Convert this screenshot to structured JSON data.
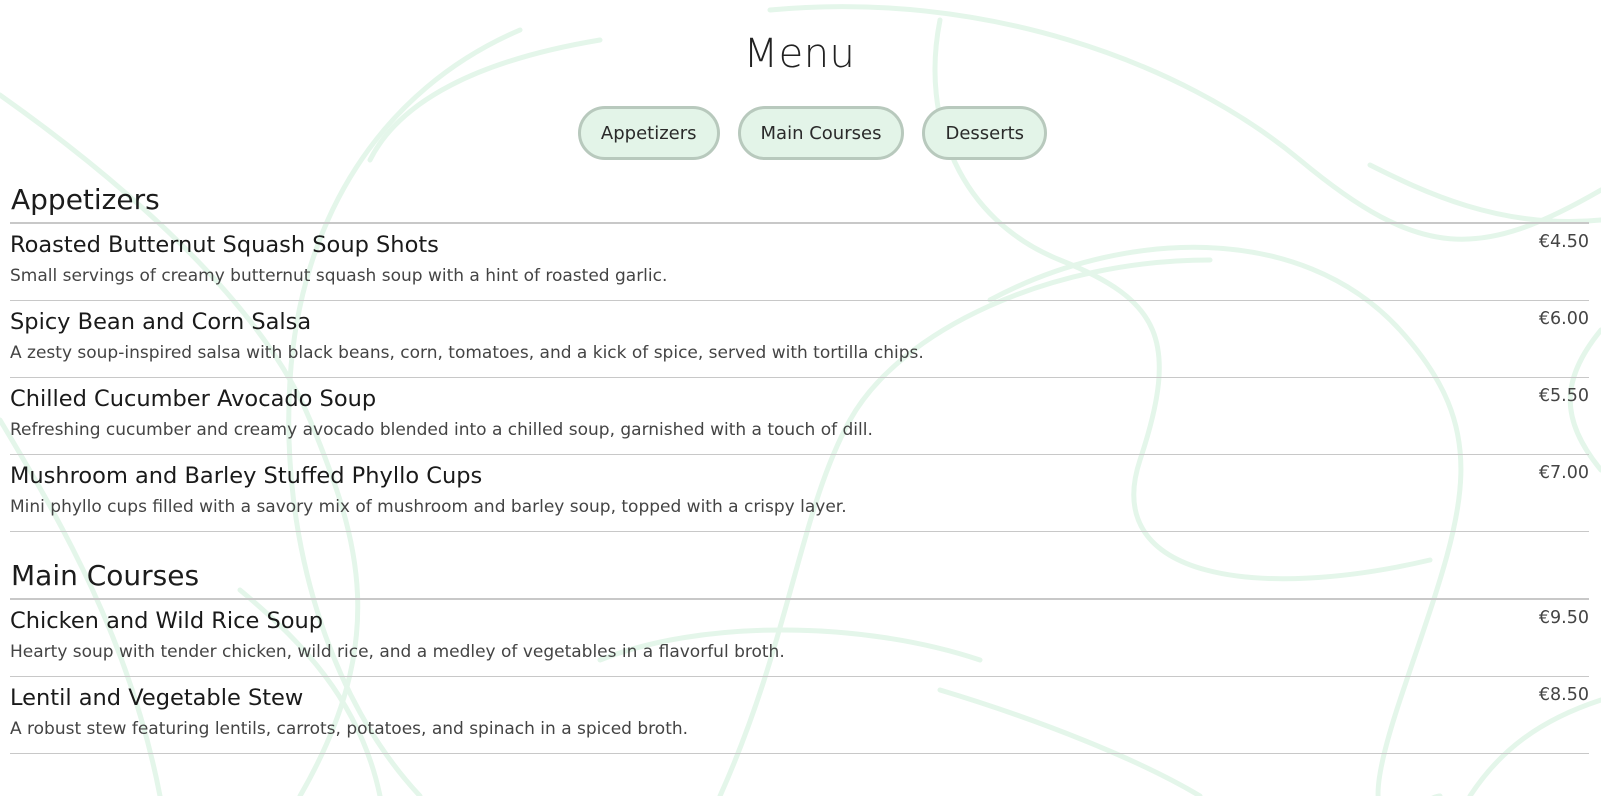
{
  "page": {
    "title": "Menu"
  },
  "categories": [
    {
      "label": "Appetizers"
    },
    {
      "label": "Main Courses"
    },
    {
      "label": "Desserts"
    }
  ],
  "sections": [
    {
      "title": "Appetizers",
      "items": [
        {
          "name": "Roasted Butternut Squash Soup Shots",
          "description": "Small servings of creamy butternut squash soup with a hint of roasted garlic.",
          "price": "€4.50"
        },
        {
          "name": "Spicy Bean and Corn Salsa",
          "description": "A zesty soup-inspired salsa with black beans, corn, tomatoes, and a kick of spice, served with tortilla chips.",
          "price": "€6.00"
        },
        {
          "name": "Chilled Cucumber Avocado Soup",
          "description": "Refreshing cucumber and creamy avocado blended into a chilled soup, garnished with a touch of dill.",
          "price": "€5.50"
        },
        {
          "name": "Mushroom and Barley Stuffed Phyllo Cups",
          "description": "Mini phyllo cups filled with a savory mix of mushroom and barley soup, topped with a crispy layer.",
          "price": "€7.00"
        }
      ]
    },
    {
      "title": "Main Courses",
      "items": [
        {
          "name": "Chicken and Wild Rice Soup",
          "description": "Hearty soup with tender chicken, wild rice, and a medley of vegetables in a flavorful broth.",
          "price": "€9.50"
        },
        {
          "name": "Lentil and Vegetable Stew",
          "description": "A robust stew featuring lentils, carrots, potatoes, and spinach in a spiced broth.",
          "price": "€8.50"
        }
      ]
    }
  ],
  "colors": {
    "button_bg": "#e3f4e8",
    "button_border": "#b8c9bd",
    "background_swirl": "#e4f6ea"
  }
}
